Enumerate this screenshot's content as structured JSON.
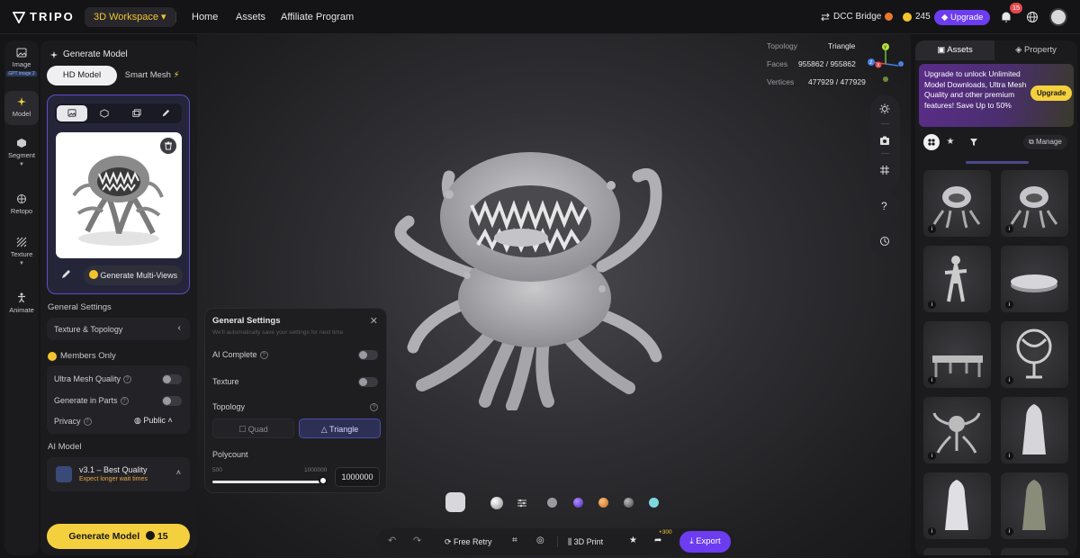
{
  "topbar": {
    "brand": "TRIPO",
    "workspace": "3D Workspace ▾",
    "nav": [
      "Home",
      "Assets",
      "Affiliate Program"
    ],
    "dcc_bridge": "DCC Bridge",
    "credits": "245",
    "upgrade": "Upgrade",
    "notification_count": "15"
  },
  "rail": {
    "items": [
      {
        "label": "Image",
        "tag": "GPT image 2"
      },
      {
        "label": "Model"
      },
      {
        "label": "Segment"
      },
      {
        "label": "Retopo"
      },
      {
        "label": "Texture"
      },
      {
        "label": "Animate"
      }
    ]
  },
  "panel": {
    "title": "Generate Model",
    "tabs": {
      "hd": "HD Model",
      "smart": "Smart Mesh"
    },
    "multiview": "Generate Multi-Views",
    "general_settings": "General Settings",
    "texture_topology": "Texture & Topology",
    "members_only": "Members Only",
    "ultra_mesh": "Ultra Mesh Quality",
    "gen_parts": "Generate in Parts",
    "privacy": "Privacy",
    "privacy_value": "Public",
    "ai_model": "AI Model",
    "model_name": "v3.1 – Best Quality",
    "model_note": "Expect longer wait times",
    "generate": "Generate Model",
    "generate_cost": "15"
  },
  "stats": {
    "topology_label": "Topology",
    "topology_value": "Triangle",
    "faces_label": "Faces",
    "faces_value": "955862 / 955862",
    "vertices_label": "Vertices",
    "vertices_value": "477929 / 477929"
  },
  "popup": {
    "title": "General Settings",
    "subtitle": "We'll automatically save your settings for next time",
    "ai_complete": "AI Complete",
    "texture": "Texture",
    "topology": "Topology",
    "quad": "Quad",
    "triangle": "Triangle",
    "polycount": "Polycount",
    "min": "500",
    "max": "1000000",
    "value": "1000000"
  },
  "bottom": {
    "free_retry": "Free Retry",
    "print": "3D Print",
    "plus": "+300",
    "export": "Export"
  },
  "assets": {
    "tab_assets": "Assets",
    "tab_property": "Property",
    "promo": "Upgrade to unlock Unlimited Model Downloads, Ultra Mesh Quality and other premium features!  Save Up to 50%",
    "promo_button": "Upgrade",
    "manage": "Manage",
    "info": "i"
  },
  "colors": {
    "accent_purple": "#6c3cf0",
    "accent_yellow": "#f4d03f",
    "bg": "#151517"
  }
}
